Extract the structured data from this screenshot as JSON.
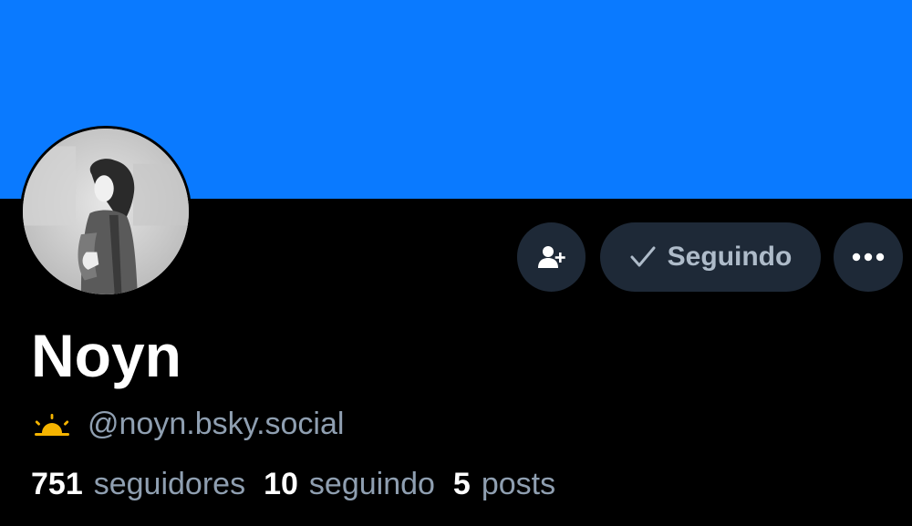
{
  "profile": {
    "banner_color": "#0a7aff",
    "avatar_icon": "avatar-image",
    "display_name": "Noyn",
    "handle_icon": "sunrise-icon",
    "handle": "@noyn.bsky.social"
  },
  "actions": {
    "add_user_icon": "add-user-icon",
    "follow_label": "Seguindo",
    "follow_icon": "check-icon",
    "more_icon": "ellipsis-icon"
  },
  "stats": {
    "followers_count": "751",
    "followers_label": "seguidores",
    "following_count": "10",
    "following_label": "seguindo",
    "posts_count": "5",
    "posts_label": "posts"
  },
  "colors": {
    "background": "#000000",
    "button_bg": "#1e2937",
    "muted_text": "#8f9fb1",
    "accent_sun": "#f5b400"
  }
}
